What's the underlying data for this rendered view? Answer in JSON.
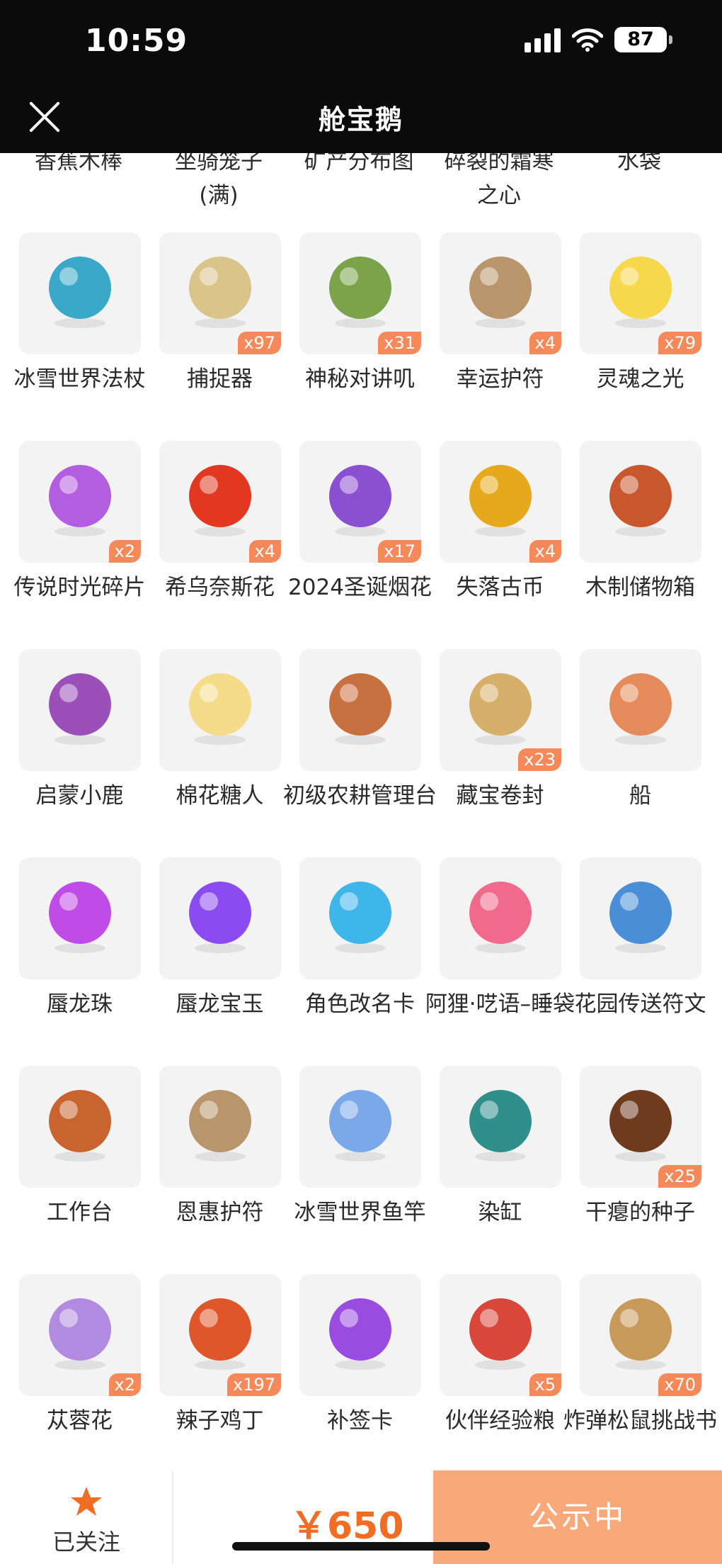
{
  "status_bar": {
    "time": "10:59",
    "battery": "87"
  },
  "header": {
    "title": "舱宝鹅"
  },
  "partial_row": [
    "香蕉木棒",
    "坐骑笼子\n(满)",
    "矿产分布图",
    "碎裂的霜寒\n之心",
    "水袋"
  ],
  "items": [
    {
      "name": "冰雪世界法杖",
      "qty": "",
      "icon": "ice-staff-icon",
      "color": "#3aa8c9"
    },
    {
      "name": "捕捉器",
      "qty": "x97",
      "icon": "thorn-crown-icon",
      "color": "#d9c48a"
    },
    {
      "name": "神秘对讲叽",
      "qty": "x31",
      "icon": "walkie-talkie-bird-icon",
      "color": "#7aa34a"
    },
    {
      "name": "幸运护符",
      "qty": "x4",
      "icon": "stone-amulet-icon",
      "color": "#b8956b"
    },
    {
      "name": "灵魂之光",
      "qty": "x79",
      "icon": "soul-light-icon",
      "color": "#f7d84a"
    },
    {
      "name": "传说时光碎片",
      "qty": "x2",
      "icon": "puzzle-shard-icon",
      "color": "#b35ee0"
    },
    {
      "name": "希乌奈斯花",
      "qty": "x4",
      "icon": "red-flower-icon",
      "color": "#e2381f"
    },
    {
      "name": "2024圣诞烟花",
      "qty": "x17",
      "icon": "fireworks-icon",
      "color": "#8b4fd1"
    },
    {
      "name": "失落古币",
      "qty": "x4",
      "icon": "gold-coin-icon",
      "color": "#e7a91c"
    },
    {
      "name": "木制储物箱",
      "qty": "",
      "icon": "wooden-crate-icon",
      "color": "#c8572d"
    },
    {
      "name": "启蒙小鹿",
      "qty": "",
      "icon": "white-deer-icon",
      "color": "#9b4fb8"
    },
    {
      "name": "棉花糖人",
      "qty": "",
      "icon": "marshmallow-creature-icon",
      "color": "#f4dc8a"
    },
    {
      "name": "初级农耕管理台",
      "qty": "",
      "icon": "farm-console-icon",
      "color": "#c8703f"
    },
    {
      "name": "藏宝卷封",
      "qty": "x23",
      "icon": "treasure-scroll-icon",
      "color": "#d6b06a"
    },
    {
      "name": "船",
      "qty": "",
      "icon": "boat-icon",
      "color": "#e58a5a"
    },
    {
      "name": "蜃龙珠",
      "qty": "",
      "icon": "purple-orb-icon",
      "color": "#c04ce8"
    },
    {
      "name": "蜃龙宝玉",
      "qty": "",
      "icon": "dragon-jade-icon",
      "color": "#8a4cf0"
    },
    {
      "name": "角色改名卡",
      "qty": "",
      "icon": "rename-card-icon",
      "color": "#3fb6e8"
    },
    {
      "name": "阿狸·呓语–睡袋",
      "qty": "",
      "icon": "fox-sleeping-bag-icon",
      "color": "#f06a8c"
    },
    {
      "name": "花园传送符文",
      "qty": "",
      "icon": "blue-crystal-icon",
      "color": "#4a8ed8"
    },
    {
      "name": "工作台",
      "qty": "",
      "icon": "workbench-icon",
      "color": "#c9632f"
    },
    {
      "name": "恩惠护符",
      "qty": "",
      "icon": "grace-amulet-icon",
      "color": "#b8956b"
    },
    {
      "name": "冰雪世界鱼竿",
      "qty": "",
      "icon": "fishing-rod-icon",
      "color": "#7aa8e8"
    },
    {
      "name": "染缸",
      "qty": "",
      "icon": "dye-vat-icon",
      "color": "#2f8f8a"
    },
    {
      "name": "干瘪的种子",
      "qty": "x25",
      "icon": "dried-seed-icon",
      "color": "#6e3b1f"
    },
    {
      "name": "苁蓉花",
      "qty": "x2",
      "icon": "cistanche-flower-icon",
      "color": "#b28be0"
    },
    {
      "name": "辣子鸡丁",
      "qty": "x197",
      "icon": "spicy-chicken-dish-icon",
      "color": "#e0562b"
    },
    {
      "name": "补签卡",
      "qty": "",
      "icon": "ticket-card-icon",
      "color": "#9a4ce0"
    },
    {
      "name": "伙伴经验粮",
      "qty": "x5",
      "icon": "food-bag-icon",
      "color": "#d9463a"
    },
    {
      "name": "炸弹松鼠挑战书",
      "qty": "x70",
      "icon": "wanted-poster-icon",
      "color": "#c89a5a"
    }
  ],
  "bottom_bar": {
    "follow_label": "已关注",
    "price": "￥650",
    "status_button": "公示中"
  },
  "colors": {
    "accent": "#f26d24",
    "badge": "#f5895a",
    "status_button": "#f9a87a"
  }
}
